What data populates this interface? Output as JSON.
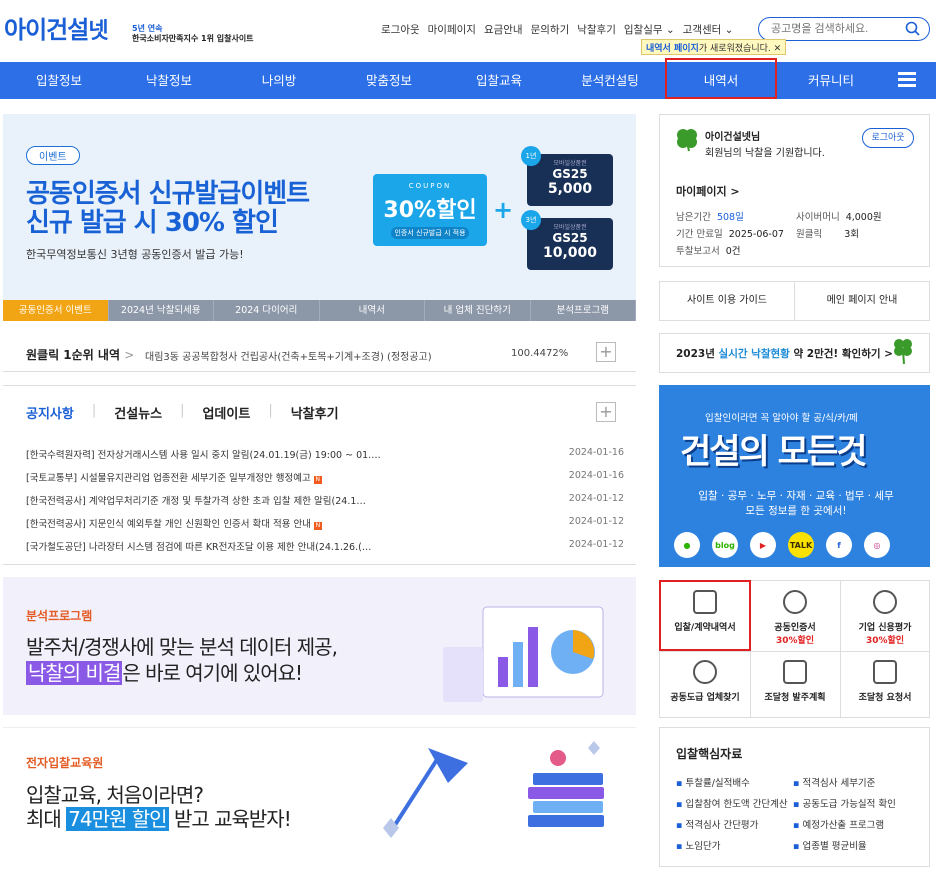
{
  "header": {
    "logo": "아이건설",
    "logo_net": "넷",
    "logo_sub1": "5년 연속",
    "logo_sub2": "한국소비자만족지수 1위 입찰사이트",
    "top_links": [
      "로그아웃",
      "마이페이지",
      "요금안내",
      "문의하기",
      "낙찰후기",
      "입찰실무 ⌄",
      "고객센터 ⌄"
    ],
    "search_placeholder": "공고명을 검색하세요.",
    "tooltip_bold": "내역서 페이지",
    "tooltip_rest": "가 새로워졌습니다.",
    "tooltip_close": "✕"
  },
  "gnb": [
    "입찰정보",
    "낙찰정보",
    "나의방",
    "맞춤정보",
    "입찰교육",
    "분석컨설팅",
    "내역서",
    "커뮤니티"
  ],
  "banner": {
    "tag": "이벤트",
    "title1": "공동인증서 신규발급이벤트",
    "title2": "신규 발급 시 30% 할인",
    "sub": "한국무역정보통신 3년형 공동인증서 발급 가능!",
    "coupon_label": "COUPON",
    "coupon_main": "30%할인",
    "coupon_sub": "인증서 신규발급 시 적용",
    "card1_year": "1년",
    "card1_brand": "GS25",
    "card1_value": "5,000",
    "card2_year": "3년",
    "card2_brand": "GS25",
    "card2_value": "10,000",
    "tabs": [
      "공동인증서 이벤트",
      "2024년 낙찰되세용",
      "2024 다이어리",
      "내역서",
      "내 업체 진단하기",
      "분석프로그램"
    ]
  },
  "winner": {
    "title": "원클릭 1순위 내역",
    "arrow": ">",
    "text": "대림3동 공공복합청사 건립공사(건축+토목+기계+조경) (정정공고)",
    "pct": "100.4472%",
    "plus": "+"
  },
  "notice": {
    "tabs": [
      "공지사항",
      "건설뉴스",
      "업데이트",
      "낙찰후기"
    ],
    "plus": "+",
    "rows": [
      {
        "text": "[한국수력원자력] 전자상거래시스템 사용 일시 중지 알림(24.01.19(금) 19:00 ~ 01.…",
        "date": "2024-01-16",
        "new": ""
      },
      {
        "text": "[국토교통부] 시설물유지관리업 업종전환 세부기준 일부개정안 행정예고",
        "date": "2024-01-16",
        "new": "N"
      },
      {
        "text": "[한국전력공사] 계약업무처리기준 개정 및 투찰가격 상한 초과 입찰 제한 알림(24.1…",
        "date": "2024-01-12",
        "new": ""
      },
      {
        "text": "[한국전력공사] 지문인식 예외투찰 개인 신원확인 인증서 확대 적용 안내",
        "date": "2024-01-12",
        "new": "N"
      },
      {
        "text": "[국가철도공단] 나라장터 시스템 점검에 따른 KR전자조달 이용 제한 안내(24.1.26.(…",
        "date": "2024-01-12",
        "new": ""
      }
    ]
  },
  "promo1": {
    "label": "분석프로그램",
    "t1": "발주처/경쟁사에 맞는 분석 데이터 제공,",
    "t2_hl": "낙찰의 비결",
    "t2_rest": "은 바로 여기에 있어요!"
  },
  "promo2": {
    "label": "전자입찰교육원",
    "t1": "입찰교육, 처음이라면?",
    "t2_a": "최대 ",
    "t2_hl": "74만원 할인",
    "t2_b": " 받고 교육받자!"
  },
  "sidebar": {
    "user_name": "아이건설넷님",
    "user_msg": "회원님의 낙찰을 기원합니다.",
    "logout": "로그아웃",
    "mypage": "마이페이지 >",
    "remain_label": "남은기간",
    "remain_value": "508일",
    "expire_label": "기간 만료일",
    "expire_value": "2025-06-07",
    "report_label": "투찰보고서",
    "report_value": "0건",
    "cyber_label": "사이버머니",
    "cyber_value": "4,000원",
    "oneclick_label": "원클릭",
    "oneclick_value": "3회",
    "guide1": "사이트 이용 가이드",
    "guide2": "메인 페이지 안내",
    "status_a": "2023년 ",
    "status_hl": "실시간 낙찰현황",
    "status_b": " 약 2만건! 확인하기 >",
    "ad_t1": "입찰인이라면 꼭 알아야 할 공/식/카/페",
    "ad_t2": "건설의 모든것",
    "ad_t3a": "입찰 · 공무 · 노무 · 자재 · 교육 · 법무 · 세무",
    "ad_t3b": "모든 정보를 한 곳에서!",
    "social": [
      "●",
      "blog",
      "▶",
      "TALK",
      "f",
      "◎"
    ],
    "quick": [
      {
        "label": "입찰/계약내역서",
        "red": ""
      },
      {
        "label": "공동인증서",
        "red": "30%할인"
      },
      {
        "label": "기업 신용평가",
        "red": "30%할인"
      },
      {
        "label": "공동도급 업체찾기",
        "red": ""
      },
      {
        "label": "조달청 발주계획",
        "red": ""
      },
      {
        "label": "조달청 요청서",
        "red": ""
      }
    ],
    "core_title": "입찰핵심자료",
    "core": [
      "투찰률/실적배수",
      "적격심사 세부기준",
      "입찰참여 한도액 간단계산",
      "공동도급 가능실적 확인",
      "적격심사 간단평가",
      "예정가산출 프로그램",
      "노임단가",
      "업종별 평균비율"
    ]
  },
  "colors": {
    "brand": "#2c6fe7",
    "highlight": "#e12121",
    "accent": "#e45b24"
  }
}
